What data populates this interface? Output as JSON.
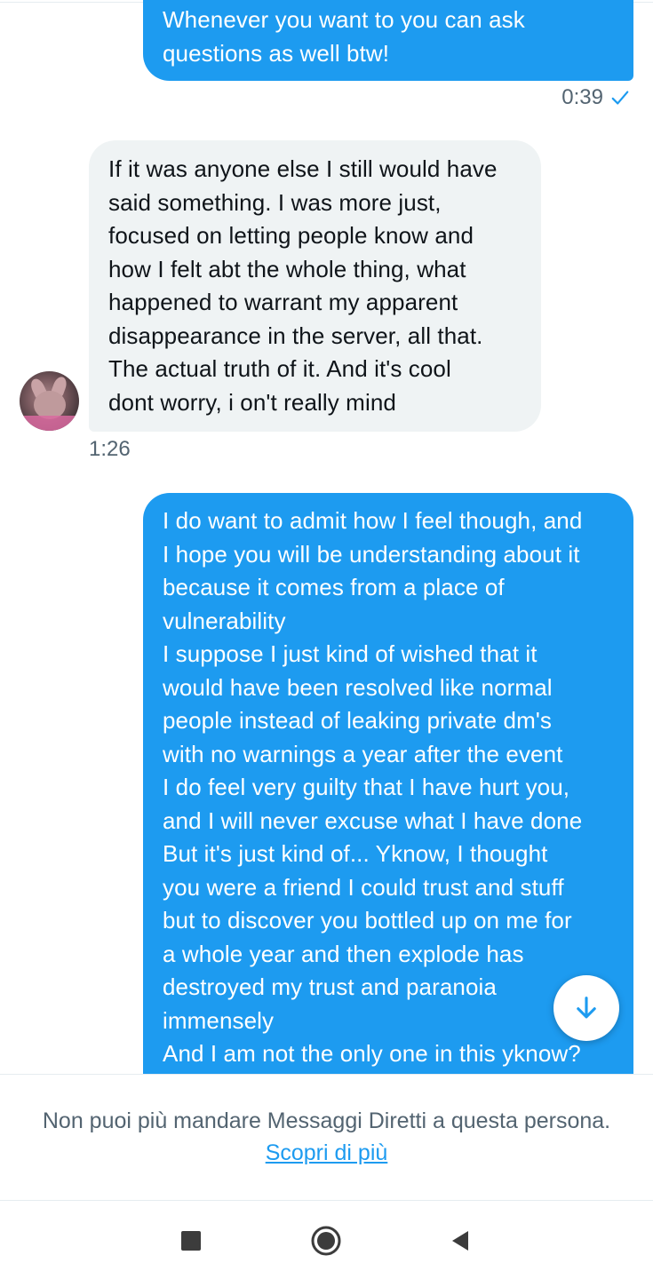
{
  "messages": [
    {
      "direction": "outgoing",
      "text": "Whenever you want to you can ask\nquestions as well btw!",
      "time": "0:39"
    },
    {
      "direction": "incoming",
      "text": "If it was anyone else I still would have\nsaid something. I was more just,\nfocused on letting people know and\nhow I felt abt the whole thing, what\nhappened to warrant my apparent\ndisappearance in the server, all that.\nThe actual truth of it. And it's cool\ndont worry, i on't really mind",
      "time": "1:26"
    },
    {
      "direction": "outgoing",
      "text": "I do want to admit how I feel though, and\nI hope you will be understanding about it\nbecause it comes from a place of\nvulnerability\nI suppose I just kind of wished that it\nwould have been resolved like normal\npeople instead of leaking private dm's\nwith no warnings a year after the event\nI do feel very guilty that I have hurt you,\nand I will never excuse what I have done\nBut it's just kind of... Yknow, I thought\nyou were a friend I could trust and stuff\nbut to discover you bottled up on me for\na whole year and then explode has\ndestroyed my trust and paranoia\nimmensely\nAnd I am not the only one in this yknow?"
    }
  ],
  "notice": {
    "text": "Non puoi più mandare Messaggi Diretti a questa persona.",
    "link": "Scopri di più"
  },
  "icons": {
    "read_receipt": "check-icon",
    "scroll_down": "arrow-down-icon",
    "nav": [
      "recent-apps-icon",
      "home-icon",
      "back-icon"
    ]
  },
  "colors": {
    "outgoing_bubble": "#1d9bf0",
    "incoming_bubble": "#eff3f4",
    "meta_text": "#536471",
    "link": "#1d9bf0"
  }
}
